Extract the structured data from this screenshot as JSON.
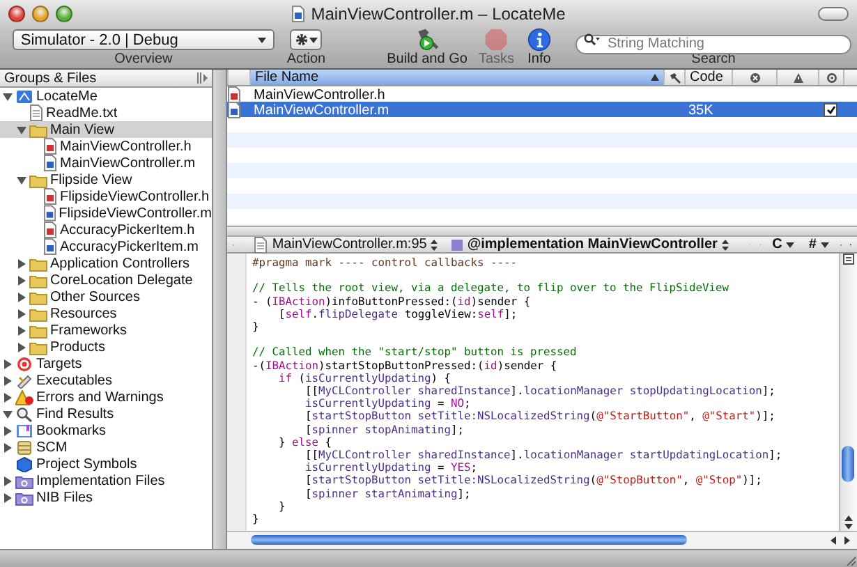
{
  "window": {
    "title": "MainViewController.m – LocateMe"
  },
  "toolbar": {
    "scheme_popup": {
      "value": "Simulator - 2.0 | Debug",
      "label": "Overview"
    },
    "action": {
      "label": "Action"
    },
    "items": [
      {
        "kind": "build",
        "label": "Build and Go",
        "disabled": false
      },
      {
        "kind": "tasks",
        "label": "Tasks",
        "disabled": true
      },
      {
        "kind": "info",
        "label": "Info",
        "disabled": false
      }
    ],
    "search": {
      "placeholder": "String Matching",
      "label": "Search"
    }
  },
  "sidebar": {
    "title": "Groups & Files",
    "items": [
      {
        "label": "LocateMe",
        "kind": "project",
        "expanded": true,
        "selected": false,
        "children": [
          {
            "label": "ReadMe.txt",
            "kind": "text",
            "selected": false
          },
          {
            "label": "Main View",
            "kind": "folder",
            "expanded": true,
            "selected": true,
            "children": [
              {
                "label": "MainViewController.h",
                "kind": "header",
                "selected": false
              },
              {
                "label": "MainViewController.m",
                "kind": "source",
                "selected": false
              }
            ]
          },
          {
            "label": "Flipside View",
            "kind": "folder",
            "expanded": true,
            "selected": false,
            "children": [
              {
                "label": "FlipsideViewController.h",
                "kind": "header",
                "selected": false
              },
              {
                "label": "FlipsideViewController.m",
                "kind": "source",
                "selected": false
              },
              {
                "label": "AccuracyPickerItem.h",
                "kind": "header",
                "selected": false
              },
              {
                "label": "AccuracyPickerItem.m",
                "kind": "source",
                "selected": false
              }
            ]
          },
          {
            "label": "Application Controllers",
            "kind": "folder",
            "expanded": false,
            "selected": false
          },
          {
            "label": "CoreLocation Delegate",
            "kind": "folder",
            "expanded": false,
            "selected": false
          },
          {
            "label": "Other Sources",
            "kind": "folder",
            "expanded": false,
            "selected": false
          },
          {
            "label": "Resources",
            "kind": "folder",
            "expanded": false,
            "selected": false
          },
          {
            "label": "Frameworks",
            "kind": "folder",
            "expanded": false,
            "selected": false
          },
          {
            "label": "Products",
            "kind": "folder",
            "expanded": false,
            "selected": false
          }
        ]
      },
      {
        "label": "Targets",
        "kind": "target",
        "expanded": false,
        "selected": false
      },
      {
        "label": "Executables",
        "kind": "executable",
        "expanded": false,
        "selected": false
      },
      {
        "label": "Errors and Warnings",
        "kind": "warning",
        "expanded": false,
        "selected": false
      },
      {
        "label": "Find Results",
        "kind": "find",
        "expanded": true,
        "selected": false
      },
      {
        "label": "Bookmarks",
        "kind": "bookmark",
        "expanded": false,
        "selected": false
      },
      {
        "label": "SCM",
        "kind": "scm",
        "expanded": false,
        "selected": false
      },
      {
        "label": "Project Symbols",
        "kind": "symbols",
        "selected": false
      },
      {
        "label": "Implementation Files",
        "kind": "smart",
        "expanded": false,
        "selected": false
      },
      {
        "label": "NIB Files",
        "kind": "smart",
        "expanded": false,
        "selected": false
      }
    ]
  },
  "table": {
    "columns": [
      {
        "kind": "text",
        "label": "File Name",
        "sorted": true
      },
      {
        "kind": "build"
      },
      {
        "kind": "text",
        "label": "Code",
        "sorted": false
      },
      {
        "kind": "errors"
      },
      {
        "kind": "warnings"
      },
      {
        "kind": "target"
      }
    ],
    "rows": [
      {
        "kind": "header",
        "name": "MainViewController.h",
        "selected": false,
        "checked": false
      },
      {
        "kind": "source",
        "name": "MainViewController.m",
        "code": "35K",
        "selected": true,
        "checked": true
      }
    ]
  },
  "navigator": {
    "file": "MainViewController.m:95",
    "symbol": "@implementation MainViewController",
    "menus": [
      "C",
      "#"
    ]
  },
  "code": [
    {
      "tokens": [
        {
          "kind": "pragma",
          "text": "#pragma mark ---- control callbacks ----"
        }
      ]
    },
    {
      "space_before": true,
      "tokens": [
        {
          "kind": "comment",
          "text": "// Tells the root view, via a delegate, to flip over to the FlipSideView"
        }
      ]
    },
    {
      "tokens": [
        {
          "kind": "text",
          "text": "- ("
        },
        {
          "kind": "kw",
          "text": "IBAction"
        },
        {
          "kind": "text",
          "text": ")infoButtonPressed:("
        },
        {
          "kind": "kw",
          "text": "id"
        },
        {
          "kind": "text",
          "text": ")sender {"
        }
      ]
    },
    {
      "tokens": [
        {
          "kind": "text",
          "text": "    ["
        },
        {
          "kind": "kw",
          "text": "self"
        },
        {
          "kind": "text",
          "text": "."
        },
        {
          "kind": "ident",
          "text": "flipDelegate"
        },
        {
          "kind": "text",
          "text": " toggleView:"
        },
        {
          "kind": "kw",
          "text": "self"
        },
        {
          "kind": "text",
          "text": "];"
        }
      ]
    },
    {
      "tokens": [
        {
          "kind": "text",
          "text": "}"
        }
      ]
    },
    {
      "space_before": true,
      "tokens": [
        {
          "kind": "comment",
          "text": "// Called when the \"start/stop\" button is pressed"
        }
      ]
    },
    {
      "tokens": [
        {
          "kind": "text",
          "text": "-("
        },
        {
          "kind": "kw",
          "text": "IBAction"
        },
        {
          "kind": "text",
          "text": ")startStopButtonPressed:("
        },
        {
          "kind": "kw",
          "text": "id"
        },
        {
          "kind": "text",
          "text": ")sender {"
        }
      ]
    },
    {
      "tokens": [
        {
          "kind": "kw",
          "text": "    if"
        },
        {
          "kind": "text",
          "text": " ("
        },
        {
          "kind": "ident",
          "text": "isCurrentlyUpdating"
        },
        {
          "kind": "text",
          "text": ") {"
        }
      ]
    },
    {
      "tokens": [
        {
          "kind": "text",
          "text": "        [["
        },
        {
          "kind": "ident",
          "text": "MyCLController sharedInstance"
        },
        {
          "kind": "text",
          "text": "]."
        },
        {
          "kind": "ident",
          "text": "locationManager stopUpdatingLocation"
        },
        {
          "kind": "text",
          "text": "];"
        }
      ]
    },
    {
      "tokens": [
        {
          "kind": "ident",
          "text": "        isCurrentlyUpdating"
        },
        {
          "kind": "text",
          "text": " = "
        },
        {
          "kind": "kw",
          "text": "NO"
        },
        {
          "kind": "text",
          "text": ";"
        }
      ]
    },
    {
      "tokens": [
        {
          "kind": "text",
          "text": "        ["
        },
        {
          "kind": "ident",
          "text": "startStopButton setTitle:NSLocalizedString"
        },
        {
          "kind": "text",
          "text": "("
        },
        {
          "kind": "string",
          "text": "@\"StartButton\""
        },
        {
          "kind": "text",
          "text": ", "
        },
        {
          "kind": "string",
          "text": "@\"Start\""
        },
        {
          "kind": "text",
          "text": ")];"
        }
      ]
    },
    {
      "tokens": [
        {
          "kind": "text",
          "text": "        ["
        },
        {
          "kind": "ident",
          "text": "spinner stopAnimating"
        },
        {
          "kind": "text",
          "text": "];"
        }
      ]
    },
    {
      "tokens": [
        {
          "kind": "text",
          "text": "    } "
        },
        {
          "kind": "kw",
          "text": "else"
        },
        {
          "kind": "text",
          "text": " {"
        }
      ]
    },
    {
      "tokens": [
        {
          "kind": "text",
          "text": "        [["
        },
        {
          "kind": "ident",
          "text": "MyCLController sharedInstance"
        },
        {
          "kind": "text",
          "text": "]."
        },
        {
          "kind": "ident",
          "text": "locationManager startUpdatingLocation"
        },
        {
          "kind": "text",
          "text": "];"
        }
      ]
    },
    {
      "tokens": [
        {
          "kind": "ident",
          "text": "        isCurrentlyUpdating"
        },
        {
          "kind": "text",
          "text": " = "
        },
        {
          "kind": "kw",
          "text": "YES"
        },
        {
          "kind": "text",
          "text": ";"
        }
      ]
    },
    {
      "tokens": [
        {
          "kind": "text",
          "text": "        ["
        },
        {
          "kind": "ident",
          "text": "startStopButton setTitle:NSLocalizedString"
        },
        {
          "kind": "text",
          "text": "("
        },
        {
          "kind": "string",
          "text": "@\"StopButton\""
        },
        {
          "kind": "text",
          "text": ", "
        },
        {
          "kind": "string",
          "text": "@\"Stop\""
        },
        {
          "kind": "text",
          "text": ")];"
        }
      ]
    },
    {
      "tokens": [
        {
          "kind": "text",
          "text": "        ["
        },
        {
          "kind": "ident",
          "text": "spinner startAnimating"
        },
        {
          "kind": "text",
          "text": "];"
        }
      ]
    },
    {
      "tokens": [
        {
          "kind": "text",
          "text": "    }"
        }
      ]
    },
    {
      "tokens": [
        {
          "kind": "text",
          "text": "}"
        }
      ]
    }
  ]
}
